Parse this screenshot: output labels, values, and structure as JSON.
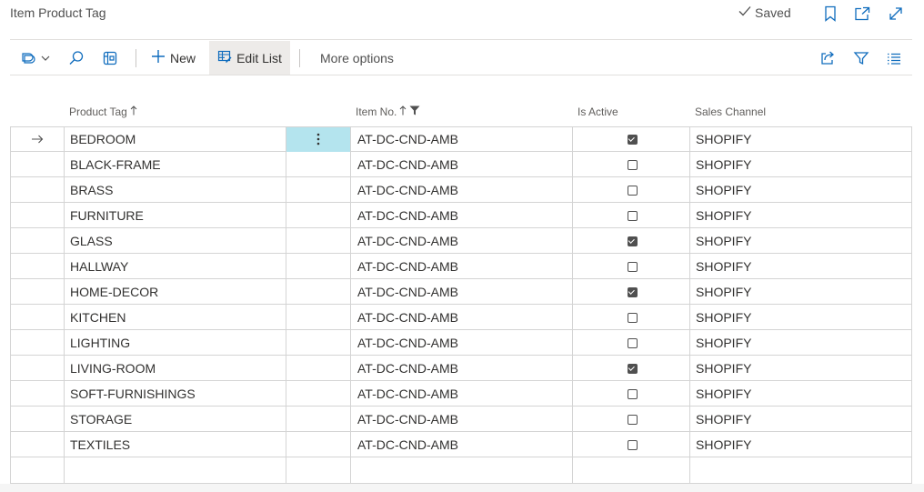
{
  "header": {
    "title": "Item Product Tag",
    "status": "Saved"
  },
  "actions": {
    "new_label": "New",
    "edit_list_label": "Edit List",
    "more_options_label": "More options"
  },
  "columns": {
    "product_tag": "Product Tag",
    "item_no": "Item No.",
    "is_active": "Is Active",
    "sales_channel": "Sales Channel"
  },
  "rows": [
    {
      "tag": "BEDROOM",
      "item_no": "AT-DC-CND-AMB",
      "active": true,
      "channel": "SHOPIFY"
    },
    {
      "tag": "BLACK-FRAME",
      "item_no": "AT-DC-CND-AMB",
      "active": false,
      "channel": "SHOPIFY"
    },
    {
      "tag": "BRASS",
      "item_no": "AT-DC-CND-AMB",
      "active": false,
      "channel": "SHOPIFY"
    },
    {
      "tag": "FURNITURE",
      "item_no": "AT-DC-CND-AMB",
      "active": false,
      "channel": "SHOPIFY"
    },
    {
      "tag": "GLASS",
      "item_no": "AT-DC-CND-AMB",
      "active": true,
      "channel": "SHOPIFY"
    },
    {
      "tag": "HALLWAY",
      "item_no": "AT-DC-CND-AMB",
      "active": false,
      "channel": "SHOPIFY"
    },
    {
      "tag": "HOME-DECOR",
      "item_no": "AT-DC-CND-AMB",
      "active": true,
      "channel": "SHOPIFY"
    },
    {
      "tag": "KITCHEN",
      "item_no": "AT-DC-CND-AMB",
      "active": false,
      "channel": "SHOPIFY"
    },
    {
      "tag": "LIGHTING",
      "item_no": "AT-DC-CND-AMB",
      "active": false,
      "channel": "SHOPIFY"
    },
    {
      "tag": "LIVING-ROOM",
      "item_no": "AT-DC-CND-AMB",
      "active": true,
      "channel": "SHOPIFY"
    },
    {
      "tag": "SOFT-FURNISHINGS",
      "item_no": "AT-DC-CND-AMB",
      "active": false,
      "channel": "SHOPIFY"
    },
    {
      "tag": "STORAGE",
      "item_no": "AT-DC-CND-AMB",
      "active": false,
      "channel": "SHOPIFY"
    },
    {
      "tag": "TEXTILES",
      "item_no": "AT-DC-CND-AMB",
      "active": false,
      "channel": "SHOPIFY"
    }
  ],
  "colors": {
    "selected_cell": "#b4e4ee",
    "accent_icon": "#0f6cbd"
  }
}
